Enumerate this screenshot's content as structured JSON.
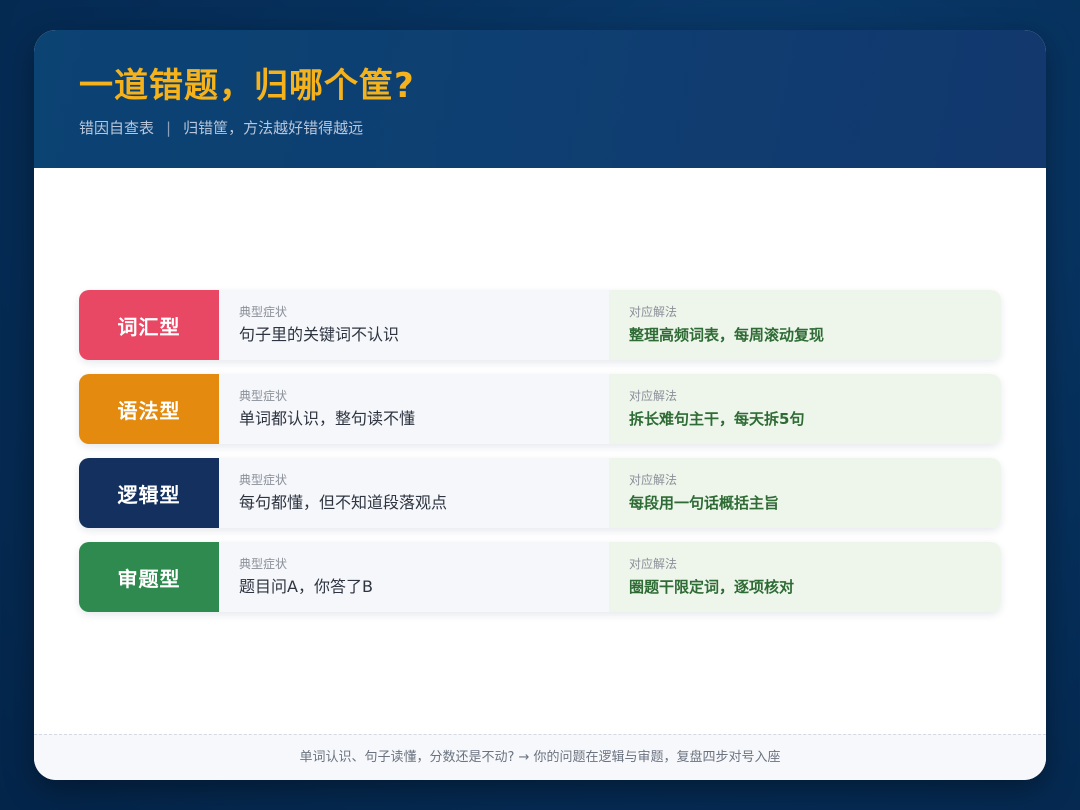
{
  "header": {
    "title": "一道错题，归哪个筐?",
    "subtitle_left": "错因自查表",
    "subtitle_sep": "|",
    "subtitle_right": "归错筐，方法越好错得越远"
  },
  "labels": {
    "symptom": "典型症状",
    "solution": "对应解法"
  },
  "rows": [
    {
      "tag": "词汇型",
      "color": "#e84864",
      "symptom": "句子里的关键词不认识",
      "solution": "整理高频词表，每周滚动复现"
    },
    {
      "tag": "语法型",
      "color": "#e38a0f",
      "symptom": "单词都认识，整句读不懂",
      "solution": "拆长难句主干，每天拆5句"
    },
    {
      "tag": "逻辑型",
      "color": "#13305e",
      "symptom": "每句都懂，但不知道段落观点",
      "solution": "每段用一句话概括主旨"
    },
    {
      "tag": "审题型",
      "color": "#2e8a4e",
      "symptom": "题目问A，你答了B",
      "solution": "圈题干限定词，逐项核对"
    }
  ],
  "footer": {
    "text": "单词认识、句子读懂，分数还是不动? → 你的问题在逻辑与审题，复盘四步对号入座"
  }
}
